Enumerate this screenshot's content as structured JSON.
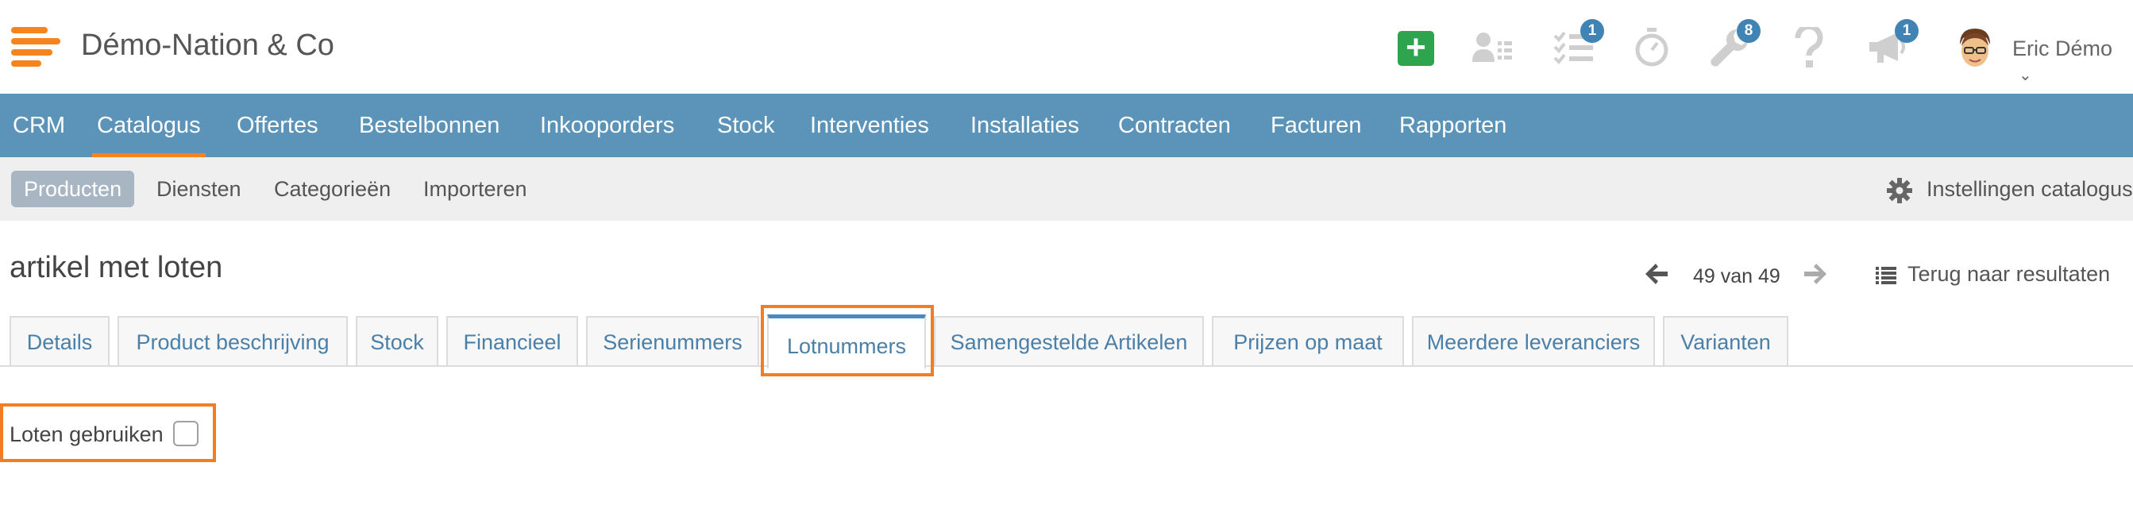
{
  "header": {
    "company_name": "Démo-Nation & Co",
    "user_name": "Eric Démo",
    "badges": {
      "tasks": "1",
      "tools": "8",
      "announcements": "1"
    },
    "accent_color": "#f5841f",
    "add_button_color": "#2ea44f"
  },
  "main_nav": {
    "items": [
      "CRM",
      "Catalogus",
      "Offertes",
      "Bestelbonnen",
      "Inkooporders",
      "Stock",
      "Interventies",
      "Installaties",
      "Contracten",
      "Facturen",
      "Rapporten"
    ],
    "active": "Catalogus",
    "background_color": "#5b94b8"
  },
  "sub_nav": {
    "items": [
      "Producten",
      "Diensten",
      "Categorieën",
      "Importeren"
    ],
    "active": "Producten",
    "settings_label": "Instellingen catalogus"
  },
  "page": {
    "title": "artikel met loten",
    "pager": "49 van 49",
    "back_label": "Terug naar resultaten"
  },
  "tabs": {
    "items": [
      "Details",
      "Product beschrijving",
      "Stock",
      "Financieel",
      "Serienummers",
      "Lotnummers",
      "Samengestelde Artikelen",
      "Prijzen op maat",
      "Meerdere leveranciers",
      "Varianten"
    ],
    "active": "Lotnummers"
  },
  "form": {
    "use_lots_label": "Loten gebruiken",
    "use_lots_checked": false
  },
  "highlight_color": "#f37d22"
}
